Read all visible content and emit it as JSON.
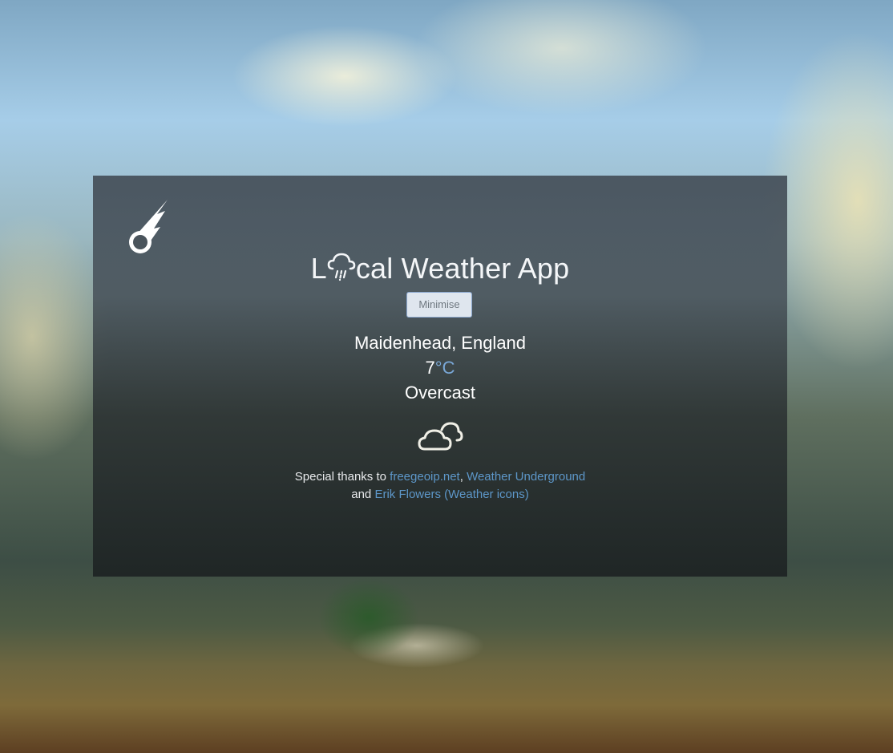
{
  "app": {
    "title_before": "L",
    "title_after": "cal Weather App",
    "title_icon": "rain-cloud-icon",
    "logo_icon": "comet-icon"
  },
  "controls": {
    "minimise_label": "Minimise"
  },
  "weather": {
    "location": "Maidenhead, England",
    "temperature": "7",
    "unit": "°C",
    "condition": "Overcast",
    "condition_icon": "cloudy-icon"
  },
  "credits": {
    "prefix": "Special thanks to ",
    "link1": "freegeoip.net",
    "sep1": ", ",
    "link2": "Weather Underground",
    "and": "and ",
    "link3": "Erik Flowers (Weather icons)"
  },
  "colors": {
    "accent": "#79a7d6",
    "link": "#5d97c9",
    "button_border": "#8aa7cf"
  }
}
